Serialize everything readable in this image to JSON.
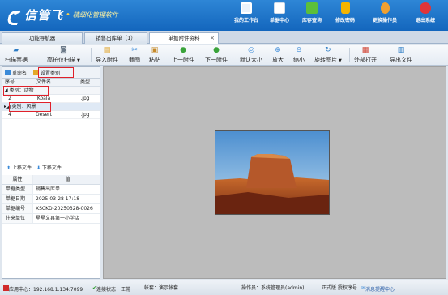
{
  "header": {
    "app_name": "信管飞",
    "app_tagline": "精细化管理软件",
    "buttons": [
      {
        "label": "我的工作台",
        "icon": "monitor-icon"
      },
      {
        "label": "单据中心",
        "icon": "document-list-icon"
      },
      {
        "label": "库存查询",
        "icon": "inventory-icon"
      },
      {
        "label": "修改密码",
        "icon": "lock-icon"
      },
      {
        "label": "更换操作员",
        "icon": "user-icon"
      },
      {
        "label": "退出系统",
        "icon": "exit-icon"
      }
    ]
  },
  "tabs": [
    {
      "label": "功能导航器"
    },
    {
      "label": "销售出库单（1）"
    },
    {
      "label": "单据附件资料",
      "active": true,
      "close": "×"
    }
  ],
  "toolbar": {
    "items": [
      {
        "label": "扫描票据",
        "icon": "scan-icon"
      },
      {
        "label": "高拍仪扫描",
        "icon": "camera-icon"
      },
      {
        "label": "导入附件",
        "icon": "import-icon"
      },
      {
        "label": "截图",
        "icon": "screenshot-icon"
      },
      {
        "label": "粘贴",
        "icon": "paste-icon"
      },
      {
        "label": "上一附件",
        "icon": "previous-icon"
      },
      {
        "label": "下一附件",
        "icon": "next-icon"
      },
      {
        "label": "默认大小",
        "icon": "default-size-icon"
      },
      {
        "label": "放大",
        "icon": "zoom-in-icon"
      },
      {
        "label": "缩小",
        "icon": "zoom-out-icon"
      },
      {
        "label": "旋转图片",
        "icon": "rotate-icon"
      },
      {
        "label": "外部打开",
        "icon": "external-open-icon"
      },
      {
        "label": "导出文件",
        "icon": "export-icon"
      }
    ]
  },
  "left_panel": {
    "rename_label": "重命名",
    "set_category_label": "设置类别",
    "columns": {
      "index": "序号",
      "filename": "文件名",
      "type": "类型"
    },
    "groups": [
      {
        "label": "类别：动物",
        "rows": [
          {
            "index": "2",
            "name": "Koala",
            "type": ".jpg"
          }
        ]
      },
      {
        "label": "类别：风景",
        "rows": [
          {
            "index": "4",
            "name": "Desert",
            "type": ".jpg"
          }
        ]
      }
    ],
    "move_up_label": "上移文件",
    "move_down_label": "下移文件",
    "properties": {
      "col_attr": "属性",
      "col_value": "值",
      "rows": [
        {
          "key": "单据类型",
          "value": "销售出库单"
        },
        {
          "key": "单据日期",
          "value": "2025-03-28 17:18"
        },
        {
          "key": "单据编号",
          "value": "XSCKD-20250328-0026"
        },
        {
          "key": "往来单位",
          "value": "星星文具第一小学店"
        }
      ]
    }
  },
  "status_bar": {
    "app_center": "应用中心：192.168.1.134:7099",
    "connection": "连接状态：正常",
    "account": "帐套：演示帐套",
    "operator": "操作员：系统管理员(admin)",
    "edition": "正式版 授权序号",
    "message_center": "消息提醒中心"
  },
  "colors": {
    "header_bg": "#1b72c8",
    "accent_red": "#e0202a"
  }
}
